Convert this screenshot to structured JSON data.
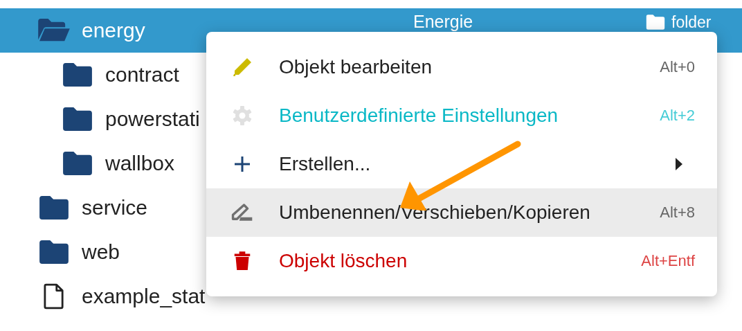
{
  "tree": [
    {
      "name": "energy",
      "kind": "folder",
      "selected": true,
      "expanded": true,
      "title": "Energie",
      "object_type": "folder",
      "children": [
        {
          "name": "contract",
          "kind": "folder",
          "selected": false
        },
        {
          "name": "powerstati",
          "kind": "folder",
          "selected": false
        },
        {
          "name": "wallbox",
          "kind": "folder",
          "selected": false
        }
      ]
    },
    {
      "name": "service",
      "kind": "folder",
      "selected": false
    },
    {
      "name": "web",
      "kind": "folder",
      "selected": false
    },
    {
      "name": "example_stat",
      "kind": "file",
      "selected": false
    }
  ],
  "context_menu": {
    "items": [
      {
        "kind": "edit",
        "label": "Objekt bearbeiten",
        "shortcut": "Alt+0",
        "selected": false
      },
      {
        "kind": "custom",
        "label": "Benutzerdefinierte Einstellungen",
        "shortcut": "Alt+2",
        "selected": false
      },
      {
        "kind": "create",
        "label": "Erstellen...",
        "submenu": true,
        "selected": false
      },
      {
        "kind": "rename",
        "label": "Umbenennen/Verschieben/Kopieren",
        "shortcut": "Alt+8",
        "selected": true
      },
      {
        "kind": "delete",
        "label": "Objekt löschen",
        "shortcut": "Alt+Entf",
        "selected": false
      }
    ]
  }
}
